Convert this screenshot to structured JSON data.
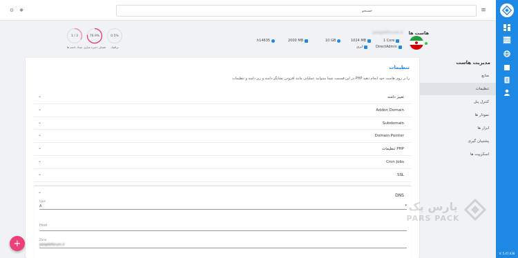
{
  "topbar": {
    "search_value": "جستجو"
  },
  "header": {
    "stats_circles": [
      {
        "value": "0.5%",
        "label": "ترافیک"
      },
      {
        "value": "76.9%",
        "label": "فضای ذخیره سازی"
      },
      {
        "value": "1 / 3",
        "label": "تعداد دامنه ها"
      }
    ],
    "host_title": "هاست ها",
    "host_email": "peopleforum.ir",
    "stats": [
      {
        "text": "1 Core"
      },
      {
        "text": "1024 MB"
      },
      {
        "text": "10 GB"
      },
      {
        "text": "2000 MB"
      },
      {
        "text": "h14635"
      },
      {
        "text": "DirectAdmin"
      },
      {
        "text": "ابری"
      }
    ]
  },
  "sidebar": {
    "title": "مدیریت هاست",
    "items": [
      {
        "label": "منابع"
      },
      {
        "label": "تنظیمات"
      },
      {
        "label": "کنترل پنل"
      },
      {
        "label": "نمودار ها"
      },
      {
        "label": "ابزار ها"
      },
      {
        "label": "پشتیبان گیری"
      },
      {
        "label": "اسکریپت ها"
      }
    ]
  },
  "card": {
    "title": "تنظیمات",
    "description": "در این قسمت شما میتوانید عملیاتی مانند افزودن نشانگر دامنه و زیر دامنه و تنظیمات PHP را بر روی هاست خود انجام دهید",
    "sections": [
      {
        "label": "تغییر دامنه"
      },
      {
        "label": "Addon Domain"
      },
      {
        "label": "Subdomain"
      },
      {
        "label": "Domain Pointer"
      },
      {
        "label": "تنظیمات PHP"
      },
      {
        "label": "Cron Jobs"
      },
      {
        "label": "SSL"
      }
    ],
    "dns": {
      "label": "DNS",
      "type_label": "type",
      "type_value": "A",
      "host_label": "Host",
      "zone_label": "Zone",
      "zone_value": "peopleforum.ir"
    }
  },
  "watermark": {
    "text": "پارس پک",
    "sub": "PARS PACK"
  },
  "version": "V: 5.47.436",
  "colors": {
    "accent": "#1e88e5",
    "fab": "#ec407a",
    "ring": "#f48fb1"
  }
}
